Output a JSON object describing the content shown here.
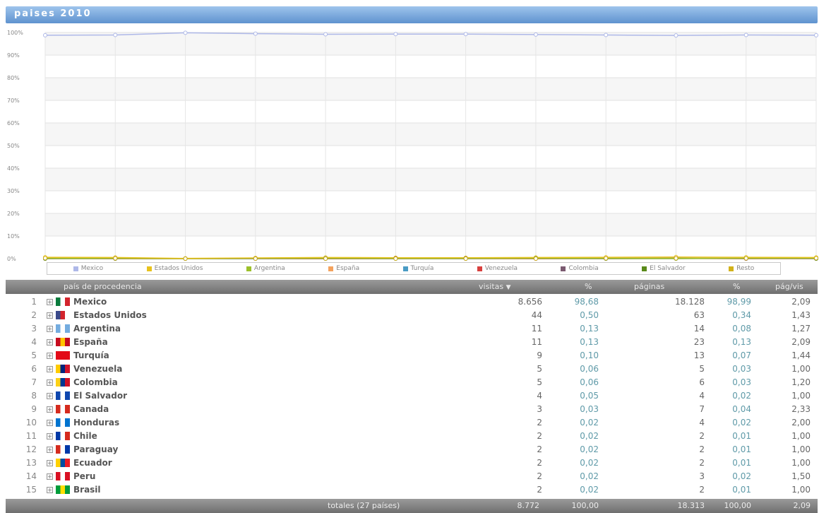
{
  "title": "paises 2010",
  "chart_data": {
    "type": "line",
    "y_ticks": [
      "100%",
      "90%",
      "80%",
      "70%",
      "60%",
      "50%",
      "40%",
      "30%",
      "20%",
      "10%",
      "0%"
    ],
    "ylim": [
      0,
      100
    ],
    "grid": true,
    "legend_position": "bottom",
    "series": [
      {
        "name": "Mexico",
        "color": "#aeb8e8",
        "values": [
          98.8,
          98.9,
          99.9,
          99.5,
          99.2,
          99.3,
          99.3,
          99.1,
          98.9,
          98.7,
          98.9,
          98.8
        ]
      },
      {
        "name": "Estados Unidos",
        "color": "#e8c21c",
        "values": [
          0.6,
          0.5,
          0.1,
          0.3,
          0.5,
          0.4,
          0.4,
          0.5,
          0.6,
          0.7,
          0.6,
          0.5
        ]
      },
      {
        "name": "Argentina",
        "color": "#9cc02a",
        "values": [
          0.1,
          0.1,
          0.0,
          0.1,
          0.1,
          0.1,
          0.1,
          0.1,
          0.1,
          0.1,
          0.1,
          0.2
        ]
      },
      {
        "name": "España",
        "color": "#f4a25d",
        "values": [
          0.1,
          0.2,
          0.0,
          0.1,
          0.1,
          0.1,
          0.1,
          0.1,
          0.1,
          0.1,
          0.1,
          0.1
        ]
      },
      {
        "name": "Turquía",
        "color": "#4a9bc4",
        "values": [
          0.1,
          0.1,
          0.0,
          0.0,
          0.1,
          0.1,
          0.0,
          0.1,
          0.1,
          0.1,
          0.1,
          0.1
        ]
      },
      {
        "name": "Venezuela",
        "color": "#d8403e",
        "values": [
          0.1,
          0.0,
          0.0,
          0.0,
          0.0,
          0.1,
          0.0,
          0.0,
          0.1,
          0.1,
          0.0,
          0.1
        ]
      },
      {
        "name": "Colombia",
        "color": "#7a5a70",
        "values": [
          0.0,
          0.1,
          0.0,
          0.0,
          0.0,
          0.0,
          0.1,
          0.0,
          0.0,
          0.1,
          0.0,
          0.0
        ]
      },
      {
        "name": "El Salvador",
        "color": "#5a8a1a",
        "values": [
          0.0,
          0.0,
          0.0,
          0.0,
          0.0,
          0.0,
          0.0,
          0.1,
          0.0,
          0.0,
          0.1,
          0.0
        ]
      },
      {
        "name": "Resto",
        "color": "#d2b21a",
        "values": [
          0.2,
          0.1,
          0.0,
          0.0,
          0.0,
          0.0,
          0.0,
          0.0,
          0.1,
          0.1,
          0.1,
          0.2
        ]
      }
    ]
  },
  "table": {
    "headers": {
      "country": "país de procedencia",
      "visitas": "visitas",
      "pct_visitas": "%",
      "paginas": "páginas",
      "pct_paginas": "%",
      "pag_vis": "pág/vis"
    },
    "rows": [
      {
        "n": "1",
        "country": "Mexico",
        "visitas": "8.656",
        "pv": "98,68",
        "paginas": "18.128",
        "pp": "98,99",
        "ppv": "2,09",
        "flag": [
          "#0a7a3c",
          "#ffffff",
          "#d3242c"
        ]
      },
      {
        "n": "2",
        "country": "Estados Unidos",
        "visitas": "44",
        "pv": "0,50",
        "paginas": "63",
        "pp": "0,34",
        "ppv": "1,43",
        "flag": [
          "#3a4a8a",
          "#d3242c",
          "#ffffff"
        ]
      },
      {
        "n": "3",
        "country": "Argentina",
        "visitas": "11",
        "pv": "0,13",
        "paginas": "14",
        "pp": "0,08",
        "ppv": "1,27",
        "flag": [
          "#74acdf",
          "#ffffff",
          "#74acdf"
        ]
      },
      {
        "n": "4",
        "country": "España",
        "visitas": "11",
        "pv": "0,13",
        "paginas": "23",
        "pp": "0,13",
        "ppv": "2,09",
        "flag": [
          "#c60b1e",
          "#ffc400",
          "#c60b1e"
        ]
      },
      {
        "n": "5",
        "country": "Turquía",
        "visitas": "9",
        "pv": "0,10",
        "paginas": "13",
        "pp": "0,07",
        "ppv": "1,44",
        "flag": [
          "#e30a17",
          "#e30a17",
          "#e30a17"
        ]
      },
      {
        "n": "6",
        "country": "Venezuela",
        "visitas": "5",
        "pv": "0,06",
        "paginas": "5",
        "pp": "0,03",
        "ppv": "1,00",
        "flag": [
          "#ffcc00",
          "#00247d",
          "#cf142b"
        ]
      },
      {
        "n": "7",
        "country": "Colombia",
        "visitas": "5",
        "pv": "0,06",
        "paginas": "6",
        "pp": "0,03",
        "ppv": "1,20",
        "flag": [
          "#fcd116",
          "#003893",
          "#ce1126"
        ]
      },
      {
        "n": "8",
        "country": "El Salvador",
        "visitas": "4",
        "pv": "0,05",
        "paginas": "4",
        "pp": "0,02",
        "ppv": "1,00",
        "flag": [
          "#0f47af",
          "#ffffff",
          "#0f47af"
        ]
      },
      {
        "n": "9",
        "country": "Canada",
        "visitas": "3",
        "pv": "0,03",
        "paginas": "7",
        "pp": "0,04",
        "ppv": "2,33",
        "flag": [
          "#d52b1e",
          "#ffffff",
          "#d52b1e"
        ]
      },
      {
        "n": "10",
        "country": "Honduras",
        "visitas": "2",
        "pv": "0,02",
        "paginas": "4",
        "pp": "0,02",
        "ppv": "2,00",
        "flag": [
          "#0073cf",
          "#ffffff",
          "#0073cf"
        ]
      },
      {
        "n": "11",
        "country": "Chile",
        "visitas": "2",
        "pv": "0,02",
        "paginas": "2",
        "pp": "0,01",
        "ppv": "1,00",
        "flag": [
          "#0039a6",
          "#ffffff",
          "#d52b1e"
        ]
      },
      {
        "n": "12",
        "country": "Paraguay",
        "visitas": "2",
        "pv": "0,02",
        "paginas": "2",
        "pp": "0,01",
        "ppv": "1,00",
        "flag": [
          "#d52b1e",
          "#ffffff",
          "#0038a8"
        ]
      },
      {
        "n": "13",
        "country": "Ecuador",
        "visitas": "2",
        "pv": "0,02",
        "paginas": "2",
        "pp": "0,01",
        "ppv": "1,00",
        "flag": [
          "#ffd100",
          "#034ea2",
          "#ed1c24"
        ]
      },
      {
        "n": "14",
        "country": "Peru",
        "visitas": "2",
        "pv": "0,02",
        "paginas": "3",
        "pp": "0,02",
        "ppv": "1,50",
        "flag": [
          "#d91023",
          "#ffffff",
          "#d91023"
        ]
      },
      {
        "n": "15",
        "country": "Brasil",
        "visitas": "2",
        "pv": "0,02",
        "paginas": "2",
        "pp": "0,01",
        "ppv": "1,00",
        "flag": [
          "#009c3b",
          "#ffdf00",
          "#009c3b"
        ]
      }
    ],
    "totals": {
      "label": "totales (27 países)",
      "visitas": "8.772",
      "pv": "100,00",
      "paginas": "18.313",
      "pp": "100,00",
      "ppv": "2,09"
    }
  },
  "icons": {
    "expand": "+",
    "sort_desc": "▼"
  }
}
